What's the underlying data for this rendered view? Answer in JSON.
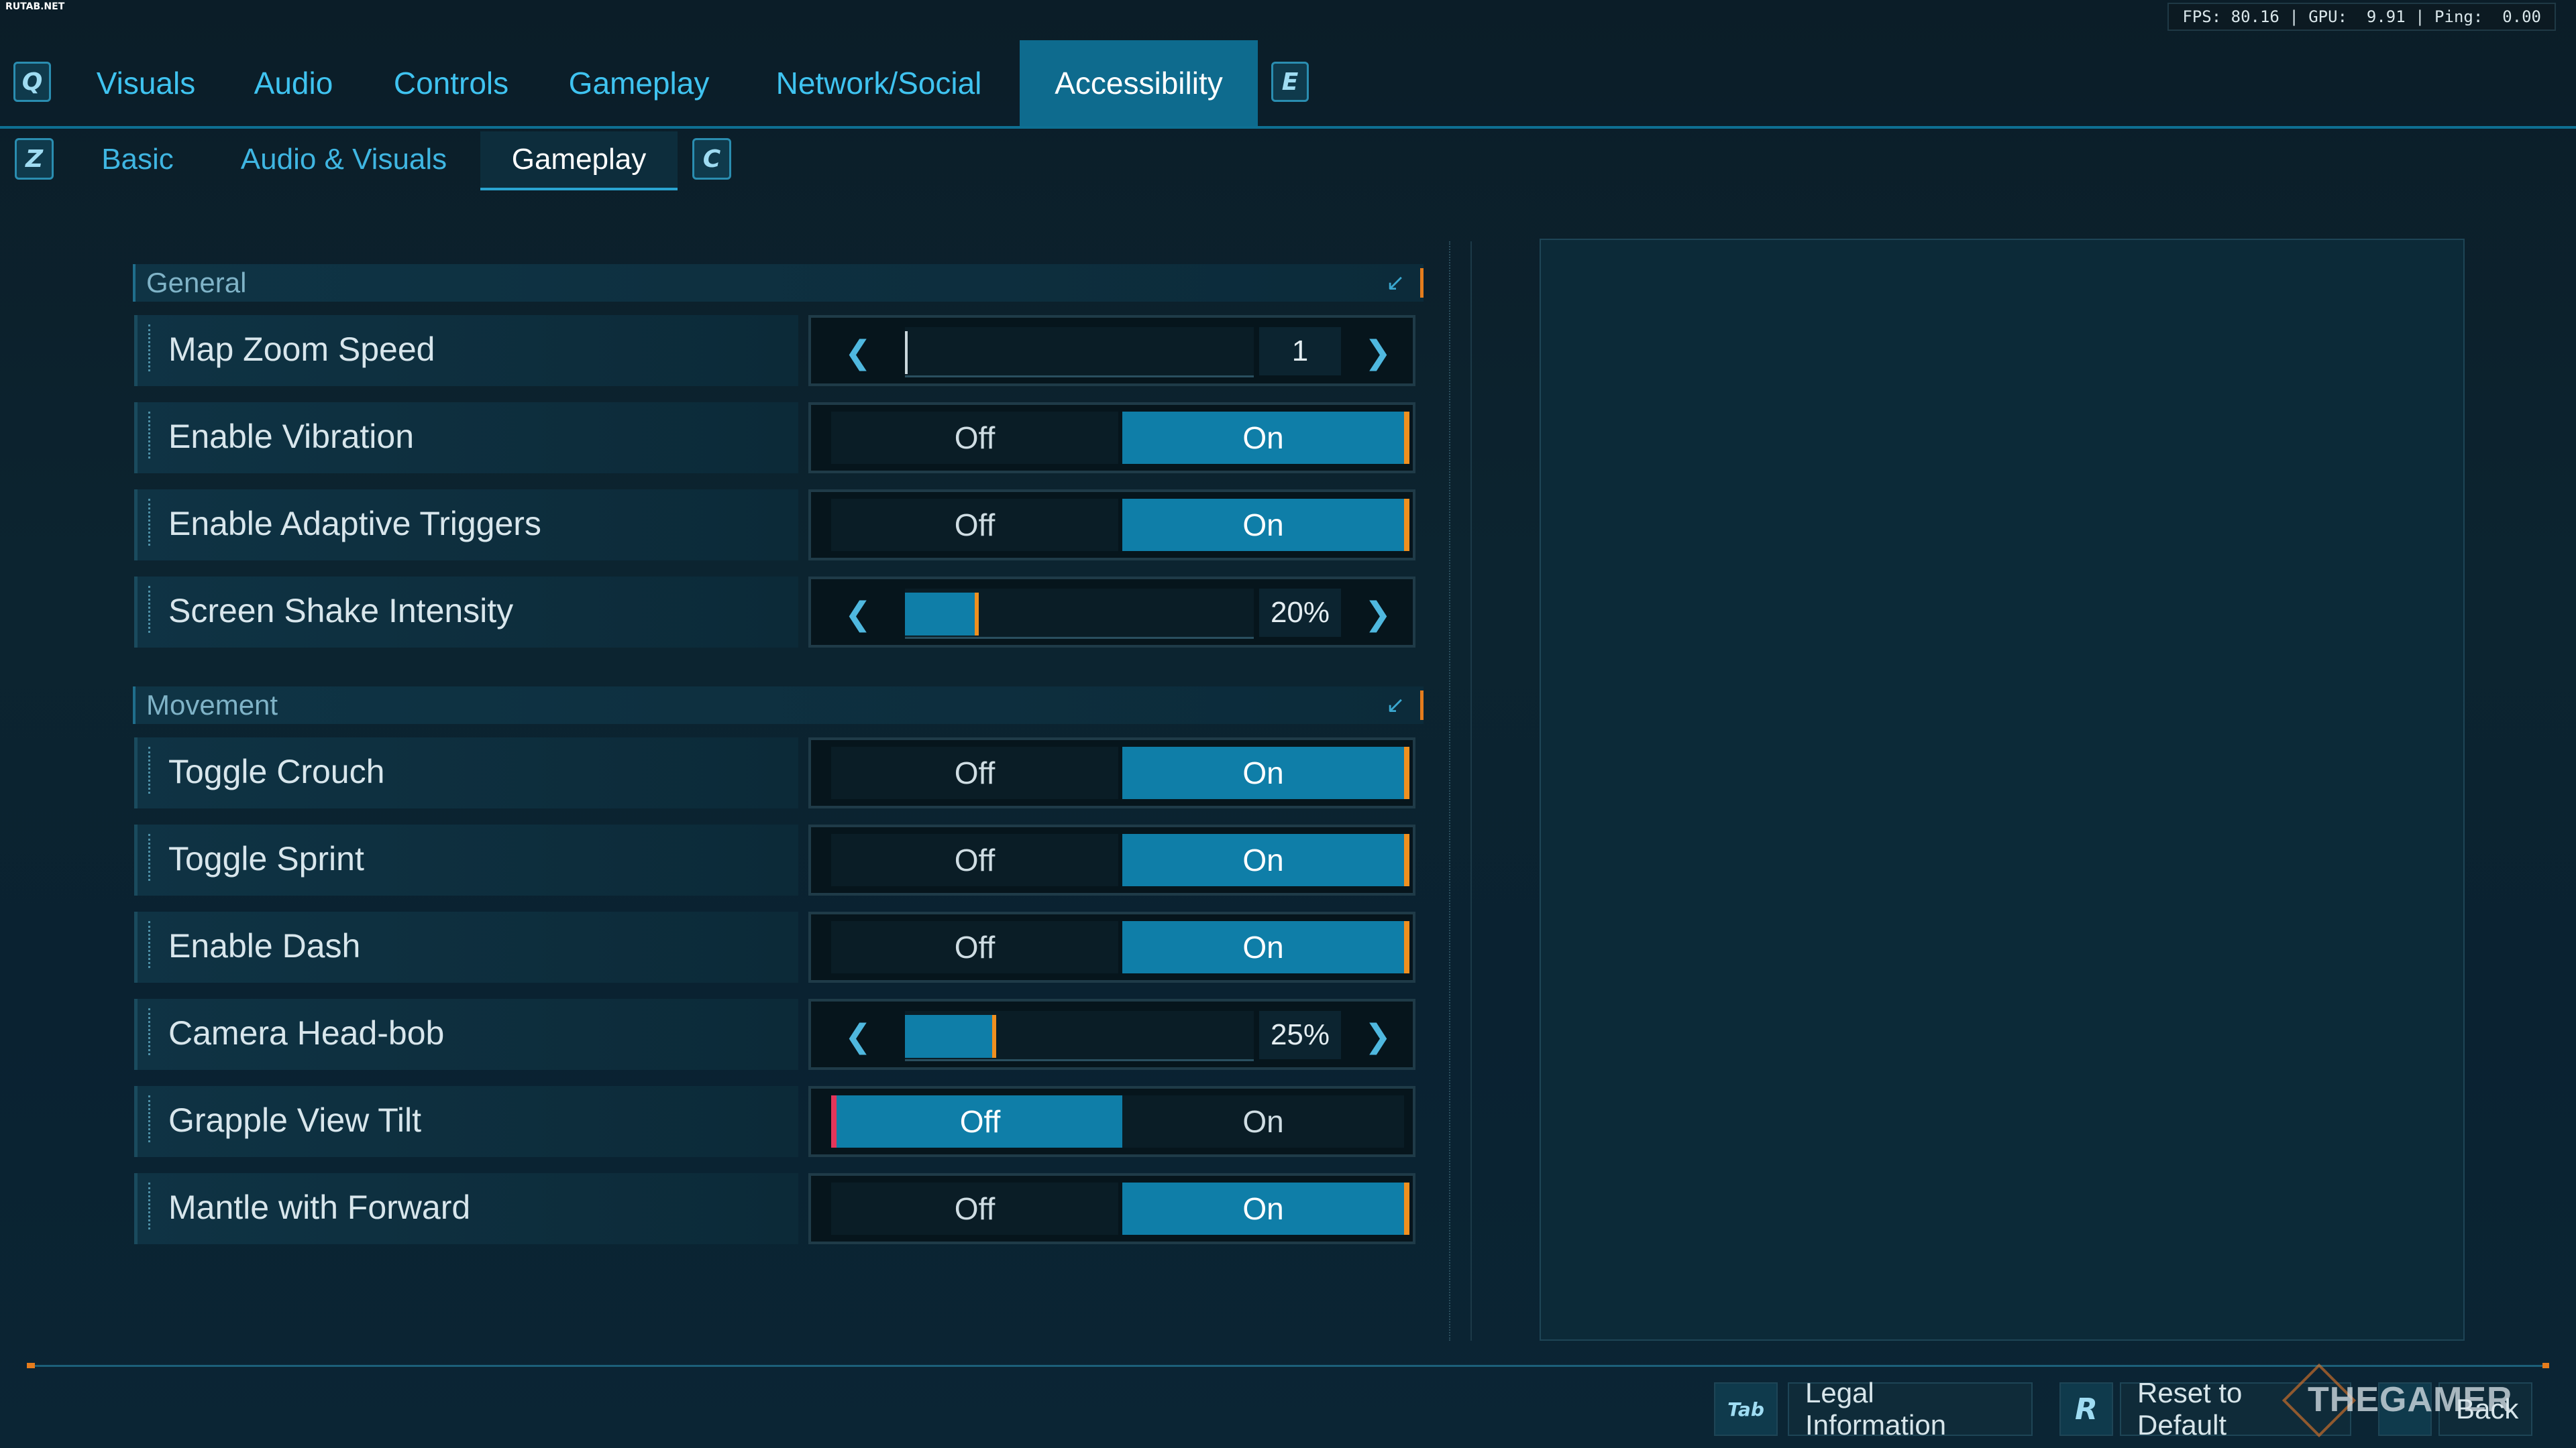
{
  "site_tag": "RUTAB.NET",
  "perf": "FPS: 80.16 | GPU:  9.91 | Ping:  0.00",
  "top_nav": {
    "prev_key": "Q",
    "next_key": "E",
    "tabs": [
      {
        "label": "Visuals"
      },
      {
        "label": "Audio"
      },
      {
        "label": "Controls"
      },
      {
        "label": "Gameplay"
      },
      {
        "label": "Network/Social"
      },
      {
        "label": "Accessibility",
        "active": true
      }
    ]
  },
  "sub_nav": {
    "prev_key": "Z",
    "next_key": "C",
    "tabs": [
      {
        "label": "Basic"
      },
      {
        "label": "Audio & Visuals"
      },
      {
        "label": "Gameplay",
        "active": true
      }
    ]
  },
  "sections": [
    {
      "label": "General"
    },
    {
      "label": "Movement"
    }
  ],
  "rows": [
    {
      "label": "Map Zoom Speed",
      "type": "slider",
      "value": "1",
      "fill": 0.0
    },
    {
      "label": "Enable Vibration",
      "type": "toggle",
      "off": "Off",
      "on": "On",
      "selected": "on"
    },
    {
      "label": "Enable Adaptive Triggers",
      "type": "toggle",
      "off": "Off",
      "on": "On",
      "selected": "on"
    },
    {
      "label": "Screen Shake Intensity",
      "type": "slider",
      "value": "20%",
      "fill": 0.2
    },
    {
      "label": "Toggle Crouch",
      "type": "toggle",
      "off": "Off",
      "on": "On",
      "selected": "on"
    },
    {
      "label": "Toggle Sprint",
      "type": "toggle",
      "off": "Off",
      "on": "On",
      "selected": "on"
    },
    {
      "label": "Enable Dash",
      "type": "toggle",
      "off": "Off",
      "on": "On",
      "selected": "on"
    },
    {
      "label": "Camera Head-bob",
      "type": "slider",
      "value": "25%",
      "fill": 0.25
    },
    {
      "label": "Grapple View Tilt",
      "type": "toggle",
      "off": "Off",
      "on": "On",
      "selected": "off"
    },
    {
      "label": "Mantle with Forward",
      "type": "toggle",
      "off": "Off",
      "on": "On",
      "selected": "on"
    }
  ],
  "footer": {
    "legal_key": "Tab",
    "legal_label": "Legal Information",
    "reset_key": "R",
    "reset_label": "Reset to Default",
    "back_label": "Back"
  },
  "watermark": "THEGAMER",
  "colors": {
    "accent": "#0f7ea8",
    "highlight": "#f0901f",
    "warning": "#e4365a"
  }
}
